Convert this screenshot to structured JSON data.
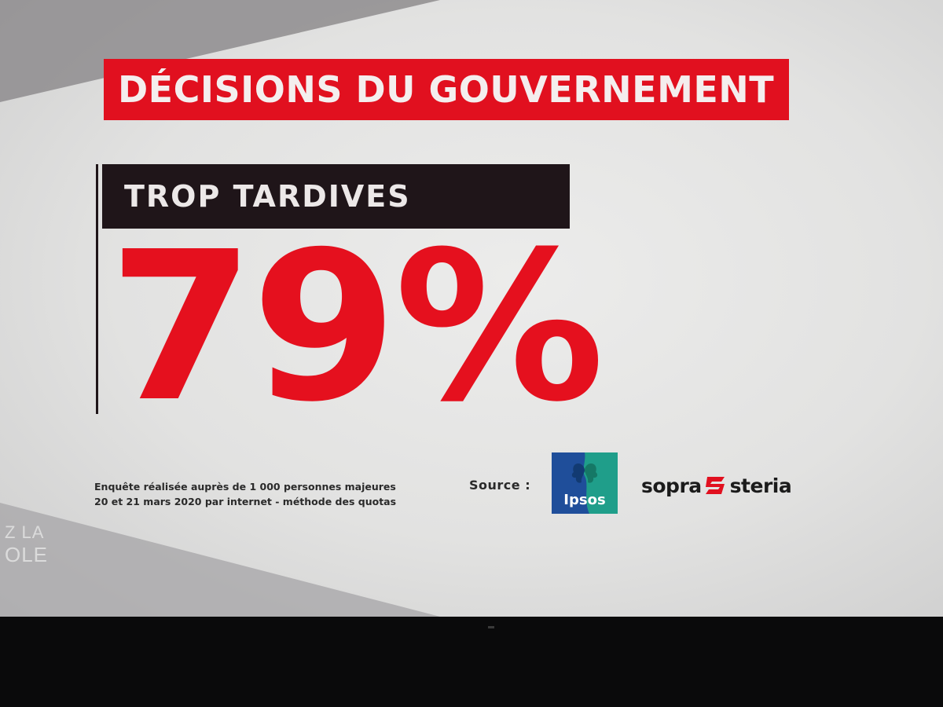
{
  "title": "DÉCISIONS DU GOUVERNEMENT",
  "label": "TROP TARDIVES",
  "value": "79%",
  "footnote": {
    "line1": "Enquête réalisée auprès de 1 000 personnes majeures",
    "line2": "20 et 21 mars 2020 par internet - méthode des quotas"
  },
  "source_label": "Source :",
  "logos": {
    "ipsos": "Ipsos",
    "sopra_left": "sopra",
    "sopra_right": "steria"
  },
  "channel_logo": {
    "line1": "Z LA",
    "line2": "OLE"
  },
  "colors": {
    "accent_red": "#e1101f",
    "label_dark": "#1f1519",
    "ipsos_blue": "#1f4e9a",
    "ipsos_green": "#1f9e8a"
  }
}
